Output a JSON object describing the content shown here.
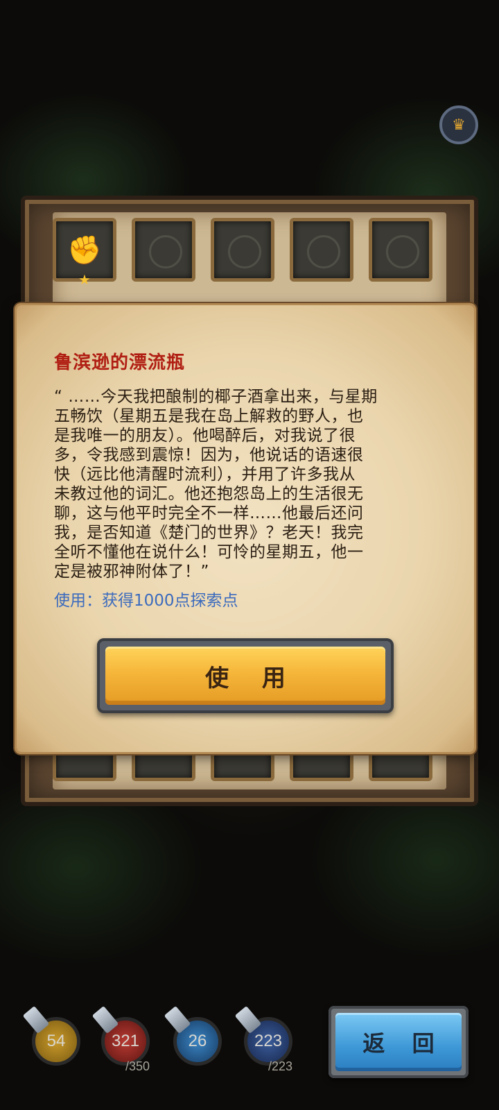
{
  "popup": {
    "title": "鲁滨逊的漂流瓶",
    "description_lines": [
      "“ ……今天我把酿制的椰子酒拿出来，与星期",
      "五畅饮（星期五是我在岛上解救的野人，也",
      "是我唯一的朋友）。他喝醉后，对我说了很",
      "多，令我感到震惊！因为，他说话的语速很",
      "快（远比他清醒时流利），并用了许多我从",
      "未教过他的词汇。他还抱怨岛上的生活很无",
      "聊，这与他平时完全不一样……他最后还问",
      "我，是否知道《楚门的世界》？老天！我完",
      "全听不懂他在说什么！可怜的星期五，他一",
      "定是被邪神附体了！”"
    ],
    "use_effect": "使用：获得1000点探索点",
    "use_button_label": "使 用"
  },
  "stats": [
    {
      "name": "attack",
      "value": "54",
      "max": "",
      "color": "#b88a1e"
    },
    {
      "name": "health",
      "value": "321",
      "max": "/350",
      "color": "#a32a24"
    },
    {
      "name": "defense",
      "value": "26",
      "max": "",
      "color": "#2a6fa8"
    },
    {
      "name": "mana",
      "value": "223",
      "max": "/223",
      "color": "#2f4f8a"
    }
  ],
  "back_button_label": "返 回",
  "equipment_slots": [
    {
      "icon": "gauntlet-icon",
      "filled": true
    },
    {
      "icon": "armor-silhouette-icon",
      "filled": false
    },
    {
      "icon": "helmet-silhouette-icon",
      "filled": false
    },
    {
      "icon": "crossbow-silhouette-icon",
      "filled": false
    },
    {
      "icon": "amulet-silhouette-icon",
      "filled": false
    }
  ]
}
